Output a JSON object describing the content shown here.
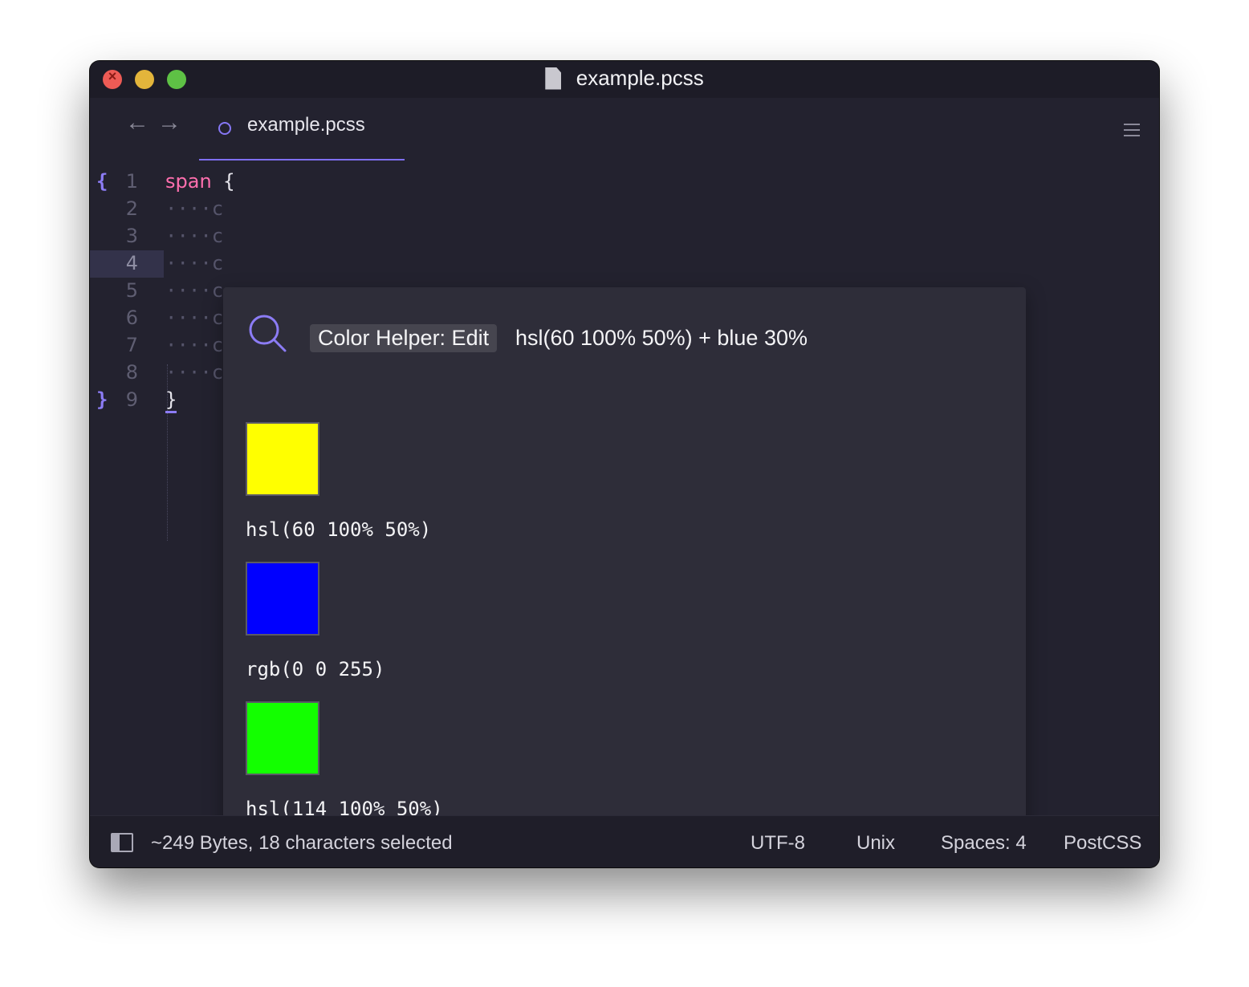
{
  "window": {
    "title": "example.pcss"
  },
  "tabbar": {
    "back_icon": "←",
    "forward_icon": "→",
    "active_tab": "example.pcss"
  },
  "editor": {
    "lines": [
      {
        "num": "1",
        "fold": "{",
        "keyword": "span",
        "rest": " {"
      },
      {
        "num": "2",
        "code": "····c"
      },
      {
        "num": "3",
        "code": "····c"
      },
      {
        "num": "4",
        "code": "····c"
      },
      {
        "num": "5",
        "code": "····c"
      },
      {
        "num": "6",
        "code": "····c"
      },
      {
        "num": "7",
        "code": "····c"
      },
      {
        "num": "8",
        "code": "····c"
      },
      {
        "num": "9",
        "fold": "}",
        "code": "}"
      }
    ]
  },
  "popup": {
    "badge": "Color Helper: Edit",
    "expression": "hsl(60 100% 50%) + blue 30%",
    "swatches": [
      {
        "color": "#ffff00",
        "label": "hsl(60 100% 50%)"
      },
      {
        "color": "#0000ff",
        "label": "rgb(0 0 255)"
      },
      {
        "color": "#13ff00",
        "label": "hsl(114 100% 50%)"
      }
    ]
  },
  "statusbar": {
    "info": "~249 Bytes, 18 characters selected",
    "encoding": "UTF-8",
    "line_endings": "Unix",
    "indent": "Spaces: 4",
    "syntax": "PostCSS"
  },
  "colors": {
    "accent": "#8c7cf5",
    "keyword": "#ff6fae",
    "background": "#23222f"
  }
}
